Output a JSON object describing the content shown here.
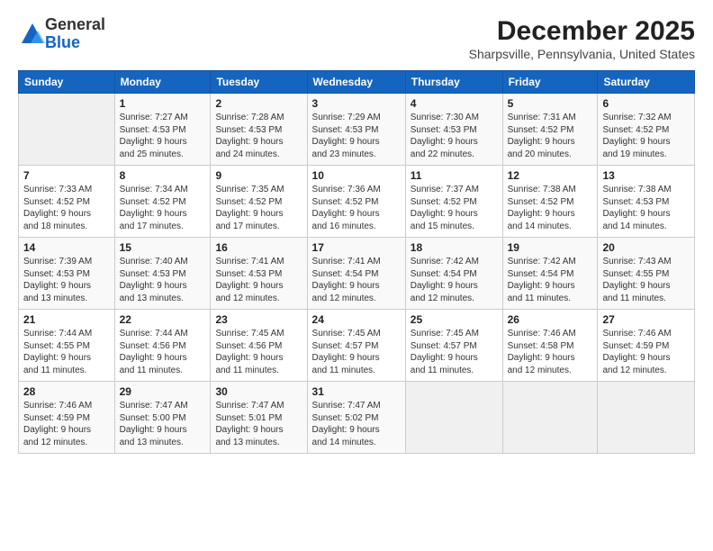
{
  "logo": {
    "general": "General",
    "blue": "Blue"
  },
  "title": "December 2025",
  "subtitle": "Sharpsville, Pennsylvania, United States",
  "weekdays": [
    "Sunday",
    "Monday",
    "Tuesday",
    "Wednesday",
    "Thursday",
    "Friday",
    "Saturday"
  ],
  "weeks": [
    [
      {
        "day": "",
        "info": ""
      },
      {
        "day": "1",
        "info": "Sunrise: 7:27 AM\nSunset: 4:53 PM\nDaylight: 9 hours\nand 25 minutes."
      },
      {
        "day": "2",
        "info": "Sunrise: 7:28 AM\nSunset: 4:53 PM\nDaylight: 9 hours\nand 24 minutes."
      },
      {
        "day": "3",
        "info": "Sunrise: 7:29 AM\nSunset: 4:53 PM\nDaylight: 9 hours\nand 23 minutes."
      },
      {
        "day": "4",
        "info": "Sunrise: 7:30 AM\nSunset: 4:53 PM\nDaylight: 9 hours\nand 22 minutes."
      },
      {
        "day": "5",
        "info": "Sunrise: 7:31 AM\nSunset: 4:52 PM\nDaylight: 9 hours\nand 20 minutes."
      },
      {
        "day": "6",
        "info": "Sunrise: 7:32 AM\nSunset: 4:52 PM\nDaylight: 9 hours\nand 19 minutes."
      }
    ],
    [
      {
        "day": "7",
        "info": "Sunrise: 7:33 AM\nSunset: 4:52 PM\nDaylight: 9 hours\nand 18 minutes."
      },
      {
        "day": "8",
        "info": "Sunrise: 7:34 AM\nSunset: 4:52 PM\nDaylight: 9 hours\nand 17 minutes."
      },
      {
        "day": "9",
        "info": "Sunrise: 7:35 AM\nSunset: 4:52 PM\nDaylight: 9 hours\nand 17 minutes."
      },
      {
        "day": "10",
        "info": "Sunrise: 7:36 AM\nSunset: 4:52 PM\nDaylight: 9 hours\nand 16 minutes."
      },
      {
        "day": "11",
        "info": "Sunrise: 7:37 AM\nSunset: 4:52 PM\nDaylight: 9 hours\nand 15 minutes."
      },
      {
        "day": "12",
        "info": "Sunrise: 7:38 AM\nSunset: 4:52 PM\nDaylight: 9 hours\nand 14 minutes."
      },
      {
        "day": "13",
        "info": "Sunrise: 7:38 AM\nSunset: 4:53 PM\nDaylight: 9 hours\nand 14 minutes."
      }
    ],
    [
      {
        "day": "14",
        "info": "Sunrise: 7:39 AM\nSunset: 4:53 PM\nDaylight: 9 hours\nand 13 minutes."
      },
      {
        "day": "15",
        "info": "Sunrise: 7:40 AM\nSunset: 4:53 PM\nDaylight: 9 hours\nand 13 minutes."
      },
      {
        "day": "16",
        "info": "Sunrise: 7:41 AM\nSunset: 4:53 PM\nDaylight: 9 hours\nand 12 minutes."
      },
      {
        "day": "17",
        "info": "Sunrise: 7:41 AM\nSunset: 4:54 PM\nDaylight: 9 hours\nand 12 minutes."
      },
      {
        "day": "18",
        "info": "Sunrise: 7:42 AM\nSunset: 4:54 PM\nDaylight: 9 hours\nand 12 minutes."
      },
      {
        "day": "19",
        "info": "Sunrise: 7:42 AM\nSunset: 4:54 PM\nDaylight: 9 hours\nand 11 minutes."
      },
      {
        "day": "20",
        "info": "Sunrise: 7:43 AM\nSunset: 4:55 PM\nDaylight: 9 hours\nand 11 minutes."
      }
    ],
    [
      {
        "day": "21",
        "info": "Sunrise: 7:44 AM\nSunset: 4:55 PM\nDaylight: 9 hours\nand 11 minutes."
      },
      {
        "day": "22",
        "info": "Sunrise: 7:44 AM\nSunset: 4:56 PM\nDaylight: 9 hours\nand 11 minutes."
      },
      {
        "day": "23",
        "info": "Sunrise: 7:45 AM\nSunset: 4:56 PM\nDaylight: 9 hours\nand 11 minutes."
      },
      {
        "day": "24",
        "info": "Sunrise: 7:45 AM\nSunset: 4:57 PM\nDaylight: 9 hours\nand 11 minutes."
      },
      {
        "day": "25",
        "info": "Sunrise: 7:45 AM\nSunset: 4:57 PM\nDaylight: 9 hours\nand 11 minutes."
      },
      {
        "day": "26",
        "info": "Sunrise: 7:46 AM\nSunset: 4:58 PM\nDaylight: 9 hours\nand 12 minutes."
      },
      {
        "day": "27",
        "info": "Sunrise: 7:46 AM\nSunset: 4:59 PM\nDaylight: 9 hours\nand 12 minutes."
      }
    ],
    [
      {
        "day": "28",
        "info": "Sunrise: 7:46 AM\nSunset: 4:59 PM\nDaylight: 9 hours\nand 12 minutes."
      },
      {
        "day": "29",
        "info": "Sunrise: 7:47 AM\nSunset: 5:00 PM\nDaylight: 9 hours\nand 13 minutes."
      },
      {
        "day": "30",
        "info": "Sunrise: 7:47 AM\nSunset: 5:01 PM\nDaylight: 9 hours\nand 13 minutes."
      },
      {
        "day": "31",
        "info": "Sunrise: 7:47 AM\nSunset: 5:02 PM\nDaylight: 9 hours\nand 14 minutes."
      },
      {
        "day": "",
        "info": ""
      },
      {
        "day": "",
        "info": ""
      },
      {
        "day": "",
        "info": ""
      }
    ]
  ]
}
